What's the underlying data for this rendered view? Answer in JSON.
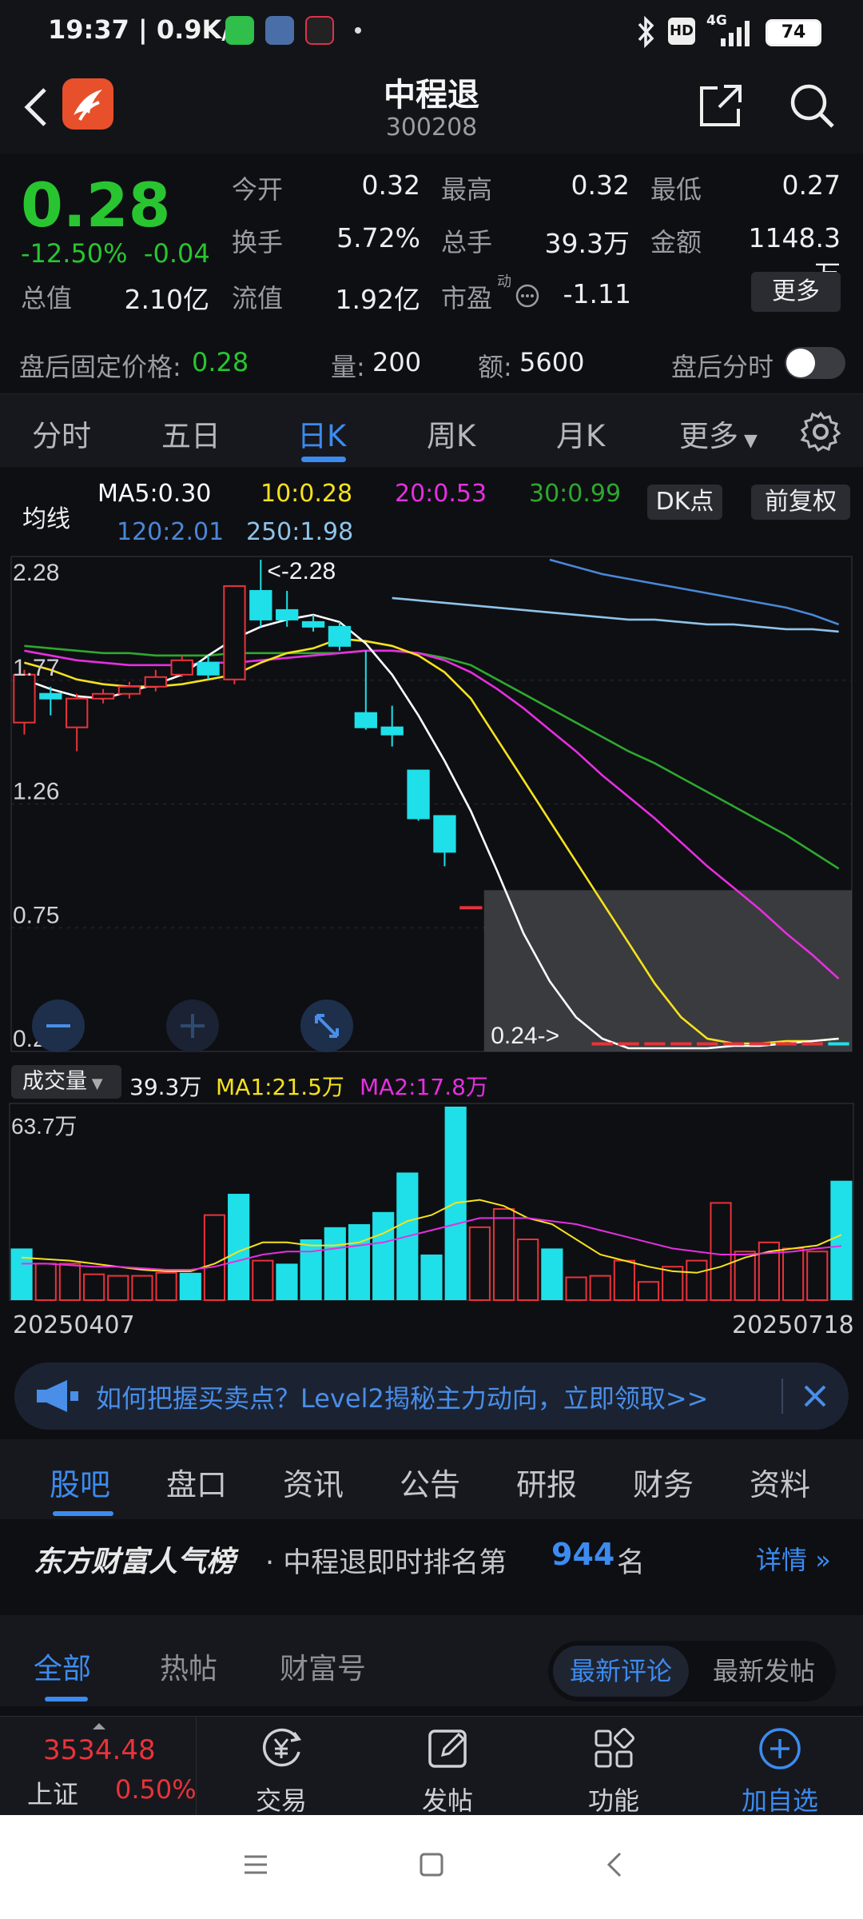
{
  "status": {
    "time_speed": "19:37 | 0.9K/s",
    "network": "4G",
    "hd": "HD",
    "battery": "74"
  },
  "header": {
    "title": "中程退",
    "code": "300208"
  },
  "quote": {
    "price": "0.28",
    "change_pct": "-12.50%",
    "change": "-0.04",
    "rows": [
      [
        {
          "l": "今开",
          "v": "0.32",
          "c": "white"
        },
        {
          "l": "最高",
          "v": "0.32",
          "c": "white"
        },
        {
          "l": "最低",
          "v": "0.27",
          "c": "green"
        }
      ],
      [
        {
          "l": "换手",
          "v": "5.72%",
          "c": "white"
        },
        {
          "l": "总手",
          "v": "39.3万",
          "c": "white"
        },
        {
          "l": "金额",
          "v": "1148.3万",
          "c": "white"
        }
      ]
    ],
    "mktcap_label": "总值",
    "mktcap": "2.10亿",
    "float_label": "流值",
    "float": "1.92亿",
    "pe_label": "市盈",
    "pe_sup": "动",
    "pe": "-1.11",
    "more": "更多"
  },
  "afterhours": {
    "price_label": "盘后固定价格:",
    "price": "0.28",
    "vol_label": "量:",
    "vol": "200",
    "amt_label": "额:",
    "amt": "5600",
    "toggle_label": "盘后分时",
    "toggle_on": false
  },
  "tabs": [
    "分时",
    "五日",
    "日K",
    "周K",
    "月K",
    "更多"
  ],
  "active_tab": "日K",
  "ma": {
    "label": "均线",
    "ma5": "MA5:0.30",
    "ma10": "10:0.28",
    "ma20": "20:0.53",
    "ma30": "30:0.99",
    "ma120": "120:2.01",
    "ma250": "250:1.98",
    "dk": "DK点",
    "adjust": "前复权",
    "colors": {
      "ma5": "#ffffff",
      "ma10": "#f6e21c",
      "ma20": "#e62fe0",
      "ma30": "#2ea82e",
      "ma120": "#4a87d8",
      "ma250": "#8fc4ea"
    }
  },
  "chart_data": {
    "type": "candlestick",
    "y_ticks": [
      "2.28",
      "1.77",
      "1.26",
      "0.75",
      "0.24"
    ],
    "ylim": [
      0.24,
      2.28
    ],
    "high_label": "<-2.28",
    "low_label": "0.24->",
    "candles": [
      {
        "o": 1.6,
        "c": 1.8,
        "h": 1.82,
        "l": 1.55
      },
      {
        "o": 1.72,
        "c": 1.7,
        "h": 1.75,
        "l": 1.63
      },
      {
        "o": 1.58,
        "c": 1.7,
        "h": 1.72,
        "l": 1.48
      },
      {
        "o": 1.7,
        "c": 1.72,
        "h": 1.74,
        "l": 1.68
      },
      {
        "o": 1.72,
        "c": 1.75,
        "h": 1.77,
        "l": 1.7
      },
      {
        "o": 1.75,
        "c": 1.79,
        "h": 1.82,
        "l": 1.73
      },
      {
        "o": 1.8,
        "c": 1.86,
        "h": 1.88,
        "l": 1.79
      },
      {
        "o": 1.85,
        "c": 1.8,
        "h": 1.88,
        "l": 1.78
      },
      {
        "o": 1.78,
        "c": 2.17,
        "h": 2.17,
        "l": 1.76
      },
      {
        "o": 2.15,
        "c": 2.03,
        "h": 2.28,
        "l": 2.0
      },
      {
        "o": 2.07,
        "c": 2.03,
        "h": 2.15,
        "l": 2.0
      },
      {
        "o": 2.02,
        "c": 2.0,
        "h": 2.05,
        "l": 1.98
      },
      {
        "o": 2.0,
        "c": 1.92,
        "h": 2.02,
        "l": 1.9
      },
      {
        "o": 1.64,
        "c": 1.58,
        "h": 1.9,
        "l": 1.57
      },
      {
        "o": 1.58,
        "c": 1.55,
        "h": 1.67,
        "l": 1.5
      },
      {
        "o": 1.4,
        "c": 1.2,
        "h": 1.4,
        "l": 1.19
      },
      {
        "o": 1.21,
        "c": 1.06,
        "h": 1.21,
        "l": 1.0
      },
      {
        "o": 0.83,
        "c": 0.83,
        "h": 0.83,
        "l": 0.83
      }
    ],
    "ma5": [
      1.78,
      1.74,
      1.71,
      1.7,
      1.73,
      1.76,
      1.8,
      1.88,
      1.95,
      2.0,
      2.03,
      2.05,
      2.02,
      1.93,
      1.8,
      1.63,
      1.44,
      1.23,
      0.98,
      0.72,
      0.52,
      0.37,
      0.28,
      0.24,
      0.24,
      0.24,
      0.24,
      0.25,
      0.25,
      0.26,
      0.27,
      0.28
    ],
    "ma10": [
      1.85,
      1.82,
      1.78,
      1.76,
      1.75,
      1.75,
      1.76,
      1.78,
      1.8,
      1.85,
      1.89,
      1.91,
      1.95,
      1.94,
      1.92,
      1.88,
      1.81,
      1.7,
      1.53,
      1.36,
      1.19,
      1.02,
      0.85,
      0.68,
      0.51,
      0.37,
      0.28,
      0.26,
      0.26,
      0.27,
      0.27,
      0.28
    ],
    "ma20": [
      1.9,
      1.88,
      1.86,
      1.85,
      1.84,
      1.84,
      1.84,
      1.85,
      1.85,
      1.86,
      1.87,
      1.88,
      1.89,
      1.9,
      1.9,
      1.89,
      1.86,
      1.81,
      1.74,
      1.66,
      1.57,
      1.48,
      1.38,
      1.29,
      1.2,
      1.1,
      1.0,
      0.91,
      0.82,
      0.72,
      0.63,
      0.53
    ],
    "ma30": [
      1.92,
      1.91,
      1.9,
      1.89,
      1.89,
      1.88,
      1.88,
      1.88,
      1.89,
      1.89,
      1.89,
      1.89,
      1.89,
      1.9,
      1.9,
      1.89,
      1.87,
      1.84,
      1.78,
      1.72,
      1.66,
      1.6,
      1.54,
      1.48,
      1.43,
      1.37,
      1.31,
      1.25,
      1.19,
      1.13,
      1.06,
      0.99
    ],
    "ma120": [
      null,
      null,
      null,
      null,
      null,
      null,
      null,
      null,
      null,
      null,
      null,
      null,
      null,
      null,
      null,
      null,
      null,
      null,
      null,
      null,
      2.28,
      2.25,
      2.22,
      2.2,
      2.18,
      2.16,
      2.14,
      2.12,
      2.1,
      2.08,
      2.05,
      2.01
    ],
    "ma250": [
      null,
      null,
      null,
      null,
      null,
      null,
      null,
      null,
      null,
      null,
      null,
      null,
      null,
      null,
      2.12,
      2.11,
      2.1,
      2.09,
      2.08,
      2.07,
      2.06,
      2.05,
      2.04,
      2.03,
      2.03,
      2.02,
      2.01,
      2.01,
      2.0,
      1.99,
      1.99,
      1.98
    ],
    "highlight_from_index": 18,
    "highlight_top": 0.9
  },
  "volume": {
    "dropdown": "成交量",
    "vol": "39.3万",
    "ma1": "MA1:21.5万",
    "ma2": "MA2:17.8万",
    "max_label": "63.7万",
    "start_date": "20250407",
    "end_date": "20250718",
    "bars": [
      {
        "v": 17,
        "c": "cyan"
      },
      {
        "v": 12,
        "c": "red"
      },
      {
        "v": 12,
        "c": "red"
      },
      {
        "v": 8.5,
        "c": "red"
      },
      {
        "v": 8,
        "c": "red"
      },
      {
        "v": 8,
        "c": "red"
      },
      {
        "v": 9,
        "c": "red"
      },
      {
        "v": 9,
        "c": "cyan"
      },
      {
        "v": 28,
        "c": "red"
      },
      {
        "v": 35,
        "c": "cyan"
      },
      {
        "v": 13,
        "c": "red"
      },
      {
        "v": 12,
        "c": "cyan"
      },
      {
        "v": 20,
        "c": "cyan"
      },
      {
        "v": 24,
        "c": "cyan"
      },
      {
        "v": 25,
        "c": "cyan"
      },
      {
        "v": 29,
        "c": "cyan"
      },
      {
        "v": 42,
        "c": "cyan"
      },
      {
        "v": 15,
        "c": "cyan"
      },
      {
        "v": 63.7,
        "c": "cyan"
      },
      {
        "v": 24,
        "c": "red"
      },
      {
        "v": 30,
        "c": "red"
      },
      {
        "v": 20,
        "c": "red"
      },
      {
        "v": 17,
        "c": "cyan"
      },
      {
        "v": 7.5,
        "c": "red"
      },
      {
        "v": 8,
        "c": "red"
      },
      {
        "v": 13,
        "c": "red"
      },
      {
        "v": 6,
        "c": "red"
      },
      {
        "v": 11,
        "c": "red"
      },
      {
        "v": 13,
        "c": "red"
      },
      {
        "v": 32,
        "c": "red"
      },
      {
        "v": 16,
        "c": "red"
      },
      {
        "v": 19,
        "c": "red"
      },
      {
        "v": 17,
        "c": "red"
      },
      {
        "v": 16,
        "c": "red"
      },
      {
        "v": 39.3,
        "c": "cyan"
      }
    ],
    "ma1_line": [
      14,
      13.5,
      13,
      12,
      11,
      10,
      9.5,
      9.5,
      12,
      16,
      19,
      19,
      18,
      18,
      19,
      22,
      26,
      28,
      32,
      33,
      31,
      27,
      25,
      20,
      15,
      13,
      11,
      9.5,
      9,
      11,
      14,
      16,
      17,
      18,
      21.5
    ],
    "ma2_line": [
      12,
      12,
      11.5,
      11,
      11,
      10.5,
      10,
      10,
      11,
      13,
      15,
      16,
      16,
      17,
      18,
      19,
      21,
      23,
      25,
      27,
      27,
      27,
      26,
      25,
      23,
      21,
      19,
      17,
      16,
      15,
      15,
      15.5,
      16,
      17,
      17.8
    ]
  },
  "banner": {
    "text": "如何把握买卖点？Level2揭秘主力动向，立即领取>>"
  },
  "section_tabs": [
    "股吧",
    "盘口",
    "资讯",
    "公告",
    "研报",
    "财务",
    "资料"
  ],
  "rank": {
    "brand": "东方财富人气榜",
    "prefix": "· 中程退即时排名第",
    "rank": "944",
    "suffix": "名",
    "detail": "详情"
  },
  "feed_tabs": [
    "全部",
    "热帖",
    "财富号"
  ],
  "feed_sort": [
    "最新评论",
    "最新发帖"
  ],
  "toolbar": {
    "index_value": "3534.48",
    "index_name": "上证",
    "index_change": "0.50%",
    "items": [
      "交易",
      "发帖",
      "功能",
      "加自选"
    ]
  }
}
